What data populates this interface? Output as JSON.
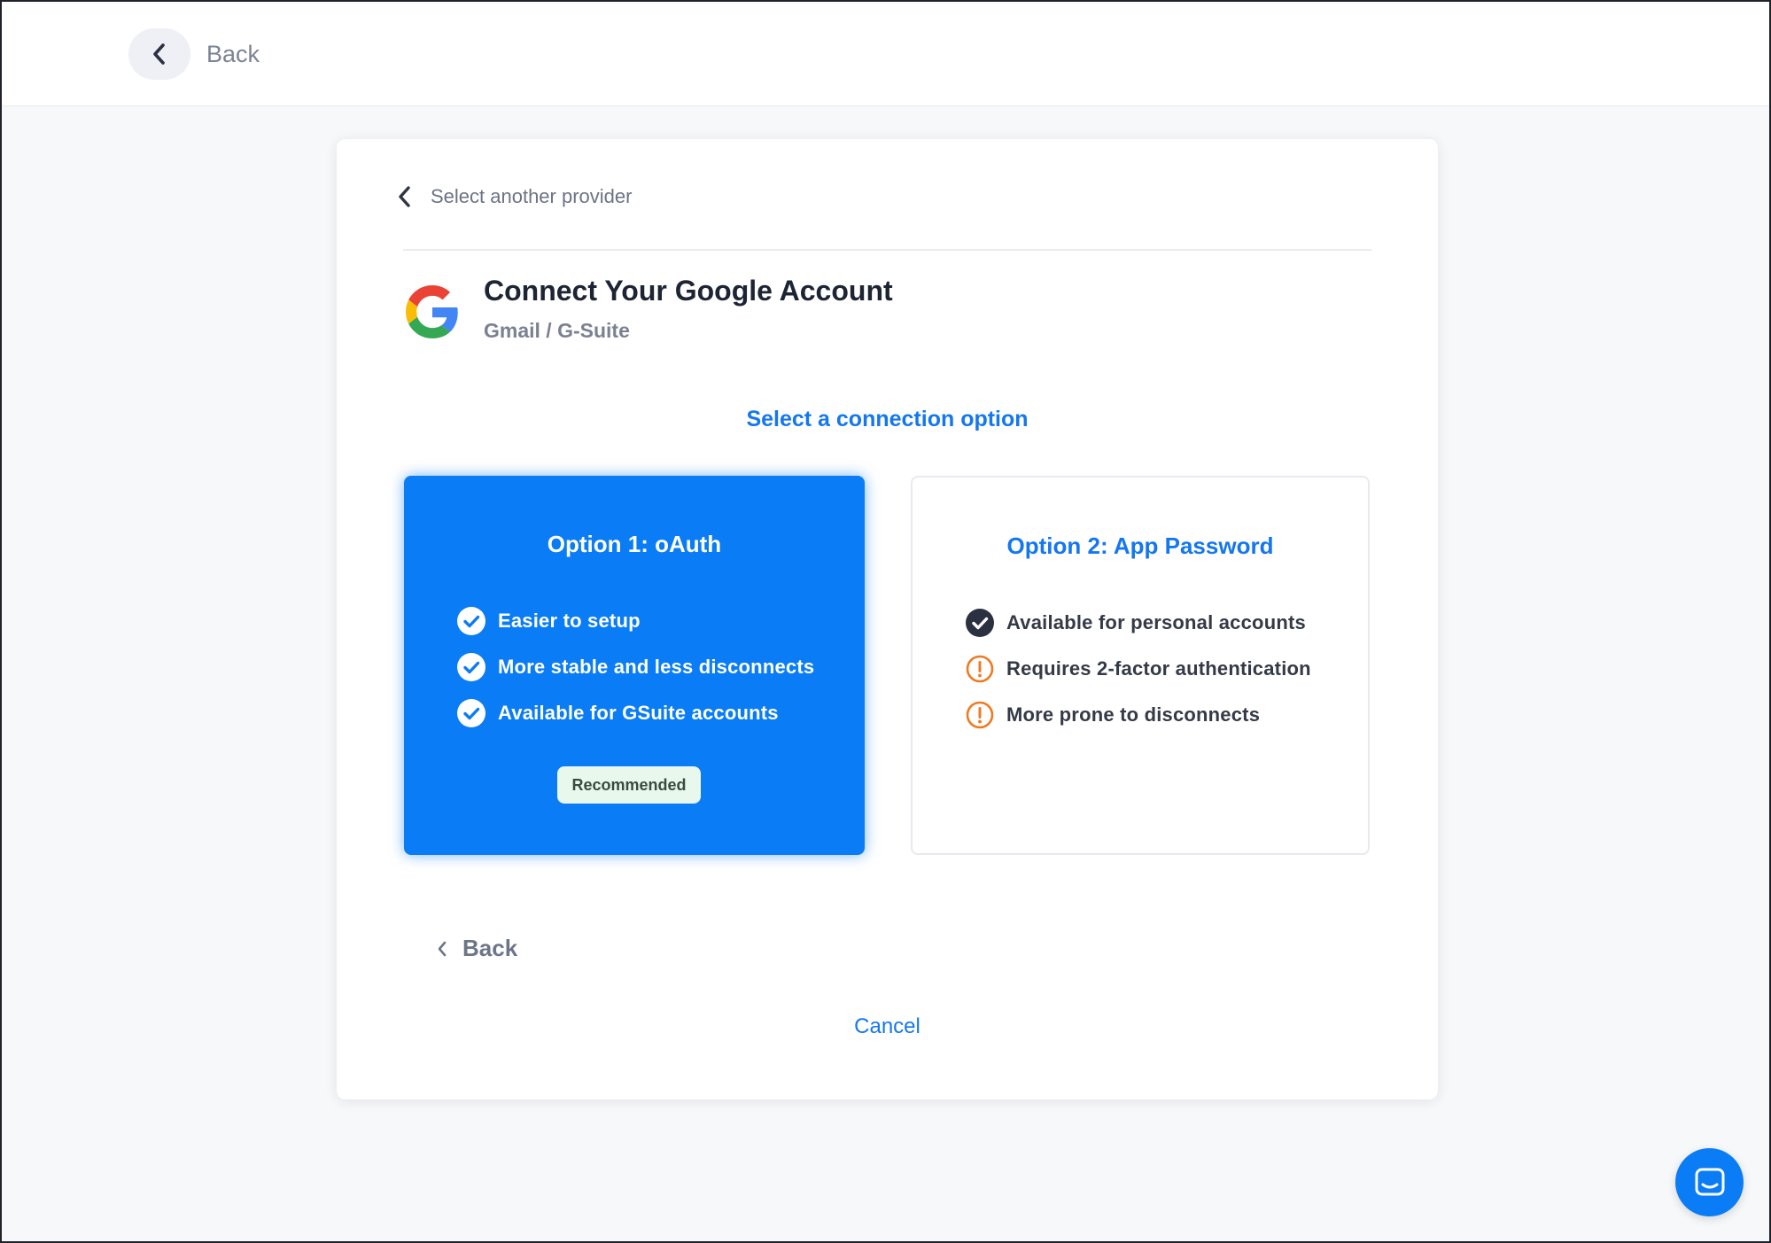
{
  "topbar": {
    "back_label": "Back"
  },
  "card": {
    "provider_link_label": "Select another provider",
    "title": "Connect Your Google Account",
    "subtitle": "Gmail / G-Suite",
    "section_heading": "Select a connection option",
    "options": [
      {
        "title": "Option 1: oAuth",
        "features": [
          {
            "text": "Easier to setup",
            "icon": "check-circle-icon"
          },
          {
            "text": "More stable and less disconnects",
            "icon": "check-circle-icon"
          },
          {
            "text": "Available for GSuite accounts",
            "icon": "check-circle-icon"
          }
        ],
        "badge": "Recommended",
        "selected": true
      },
      {
        "title": "Option 2: App Password",
        "features": [
          {
            "text": "Available for personal accounts",
            "icon": "check-circle-icon"
          },
          {
            "text": "Requires 2-factor authentication",
            "icon": "warning-circle-icon"
          },
          {
            "text": "More prone to disconnects",
            "icon": "warning-circle-icon"
          }
        ],
        "selected": false
      }
    ],
    "back_label": "Back",
    "cancel_label": "Cancel"
  },
  "colors": {
    "accent": "#0a7cf5",
    "link": "#1477f0",
    "warning": "#ef7a22",
    "badge_bg": "#e8f8ec"
  }
}
